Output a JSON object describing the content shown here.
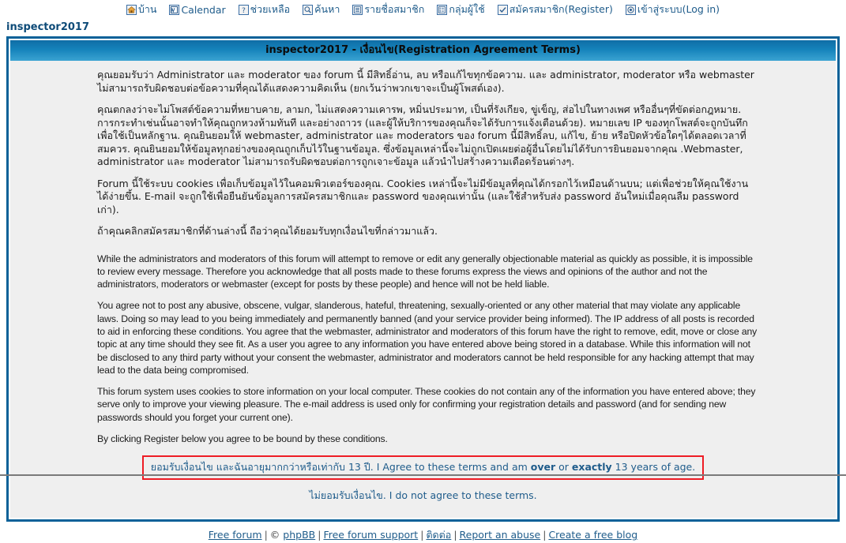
{
  "nav": {
    "items": [
      {
        "label": "บ้าน",
        "icon": "home-icon"
      },
      {
        "label": "Calendar",
        "icon": "calendar-icon"
      },
      {
        "label": "ช่วยเหลือ",
        "icon": "help-icon"
      },
      {
        "label": "ค้นหา",
        "icon": "search-icon"
      },
      {
        "label": "รายชื่อสมาชิก",
        "icon": "memberlist-icon"
      },
      {
        "label": "กลุ่มผู้ใช้",
        "icon": "usergroups-icon"
      },
      {
        "label": "สมัครสมาชิก(Register)",
        "icon": "register-icon"
      },
      {
        "label": "เข้าสู่ระบบ(Log in)",
        "icon": "login-icon"
      }
    ]
  },
  "board": {
    "title": "inspector2017"
  },
  "panel": {
    "header": "inspector2017 - เงื่อนไข(Registration Agreement Terms)"
  },
  "terms": {
    "th_1": "คุณยอมรับว่า Administrator และ moderator ของ forum นี้ มีสิทธิ์อ่าน, ลบ หรือแก้ไขทุกข้อความ. และ administrator, moderator หรือ webmaster ไม่สามารถรับผิดชอบต่อข้อความที่คุณได้แสดงความคิดเห็น (ยกเว้นว่าพวกเขาจะเป็นผู้โพสต์เอง).",
    "th_2": "คุณตกลงว่าจะไม่โพสต์ข้อความที่หยาบคาย, ลามก, ไม่แสดงความเคารพ, หมิ่นประมาท, เป็นที่รังเกียจ, ขู่เข็ญ, ส่อไปในทางเพศ หรืออื่นๆที่ขัดต่อกฎหมาย. การกระทำเช่นนั้นอาจทำให้คุณถูกหวงห้ามทันที และอย่างถาวร (และผู้ให้บริการของคุณก็จะได้รับการแจ้งเตือนด้วย). หมายเลข IP ของทุกโพสต์จะถูกบันทึกเพื่อใช้เป็นหลักฐาน. คุณยินยอมให้ webmaster, administrator และ moderators ของ forum นี้มีสิทธิ์ลบ, แก้ไข, ย้าย หรือปิดหัวข้อใดๆได้ตลอดเวลาที่สมควร. คุณยินยอมให้ข้อมูลทุกอย่างของคุณถูกเก็บไว้ในฐานข้อมูล. ซึ่งข้อมูลเหล่านี้จะไม่ถูกเปิดเผยต่อผู้อื่นโดยไม่ได้รับการยินยอมจากคุณ .Webmaster, administrator และ moderator ไม่สามารถรับผิดชอบต่อการถูกเจาะข้อมูล แล้วนำไปสร้างความเดือดร้อนต่างๆ.",
    "th_3": "Forum นี้ใช้ระบบ cookies เพื่อเก็บข้อมูลไว้ในคอมพิวเตอร์ของคุณ. Cookies เหล่านี้จะไม่มีข้อมูลที่คุณได้กรอกไว้เหมือนด้านบน; แต่เพื่อช่วยให้คุณใช้งานได้ง่ายขึ้น. E-mail จะถูกใช้เพื่อยืนยันข้อมูลการสมัครสมาชิกและ password ของคุณเท่านั้น (และใช้สำหรับส่ง password อันใหม่เมื่อคุณลืม password เก่า).",
    "th_4": "ถ้าคุณคลิกสมัครสมาชิกที่ด้านล่างนี้ ถือว่าคุณได้ยอมรับทุกเงื่อนไขที่กล่าวมาแล้ว.",
    "en_1": "While the administrators and moderators of this forum will attempt to remove or edit any generally objectionable material as quickly as possible, it is impossible to review every message. Therefore you acknowledge that all posts made to these forums express the views and opinions of the author and not the administrators, moderators or webmaster (except for posts by these people) and hence will not be held liable.",
    "en_2": "You agree not to post any abusive, obscene, vulgar, slanderous, hateful, threatening, sexually-oriented or any other material that may violate any applicable laws. Doing so may lead to you being immediately and permanently banned (and your service provider being informed). The IP address of all posts is recorded to aid in enforcing these conditions. You agree that the webmaster, administrator and moderators of this forum have the right to remove, edit, move or close any topic at any time should they see fit. As a user you agree to any information you have entered above being stored in a database. While this information will not be disclosed to any third party without your consent the webmaster, administrator and moderators cannot be held responsible for any hacking attempt that may lead to the data being compromised.",
    "en_3": "This forum system uses cookies to store information on your local computer. These cookies do not contain any of the information you have entered above; they serve only to improve your viewing pleasure. The e-mail address is used only for confirming your registration details and password (and for sending new passwords should you forget your current one).",
    "en_4": "By clicking Register below you agree to be bound by these conditions."
  },
  "agreement": {
    "accept_part1": "ยอมรับเงื่อนไข และฉันอายุมากกว่าหรือเท่ากับ 13 ปี. I Agree to these terms and am ",
    "accept_bold1": "over",
    "accept_part2": " or ",
    "accept_bold2": "exactly",
    "accept_part3": " 13 years of age.",
    "decline": "ไม่ยอมรับเงื่อนไข. I do not agree to these terms.",
    "border_color": "#ee1c25"
  },
  "footer": {
    "links": [
      {
        "label": "Free forum"
      },
      {
        "label": "phpBB"
      },
      {
        "label": "Free forum support"
      },
      {
        "label": "ติดต่อ"
      },
      {
        "label": "Report an abuse"
      },
      {
        "label": "Create a free blog"
      }
    ],
    "copyright_symbol": "©",
    "separator": "|"
  },
  "colors": {
    "accent": "#0a6198",
    "link": "#1f5c8b",
    "panel_bg": "#efefef",
    "alert": "#ee1c25"
  }
}
